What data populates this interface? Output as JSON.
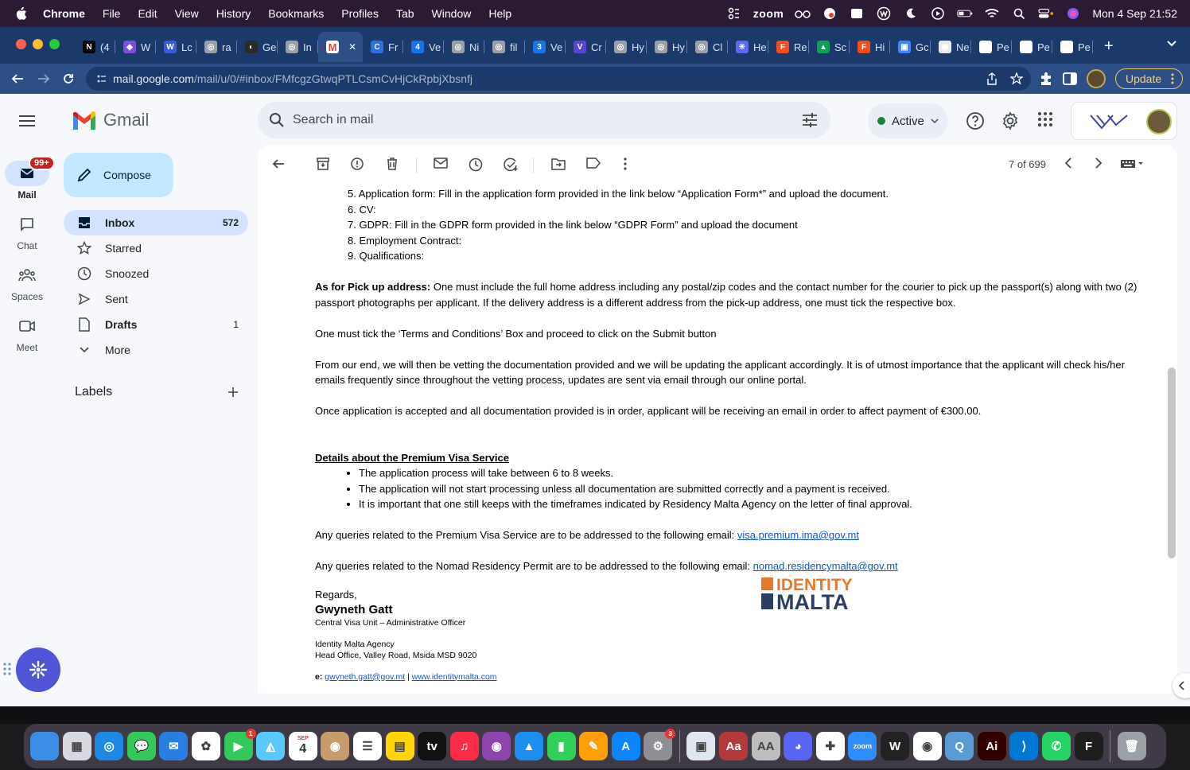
{
  "menubar": {
    "app": "Chrome",
    "items": [
      "File",
      "Edit",
      "View",
      "History",
      "Bookmarks",
      "Profiles",
      "Tab",
      "Window",
      "Help"
    ],
    "zoom_label": "zoom",
    "clock": "Mon 4 Sep  21:52"
  },
  "tabs": [
    {
      "label": "(4",
      "color": "#000000",
      "glyph": "N"
    },
    {
      "label": "W",
      "color": "#7b4fd8",
      "glyph": "◆"
    },
    {
      "label": "Lc",
      "color": "#3b5bdb",
      "glyph": "W"
    },
    {
      "label": "ra",
      "color": "#9aa0a6",
      "glyph": "◎"
    },
    {
      "label": "Ge",
      "color": "#2a2a2a",
      "glyph": "◐"
    },
    {
      "label": "In",
      "color": "#9aa0a6",
      "glyph": "◎"
    },
    {
      "label": "",
      "color": "#ffffff",
      "glyph": "M",
      "active": true
    },
    {
      "label": "Fr",
      "color": "#2f6fe0",
      "glyph": "C"
    },
    {
      "label": "Ve",
      "color": "#1a73e8",
      "glyph": "4"
    },
    {
      "label": "Ni",
      "color": "#9aa0a6",
      "glyph": "◎"
    },
    {
      "label": "fil",
      "color": "#9aa0a6",
      "glyph": "◎"
    },
    {
      "label": "Ve",
      "color": "#1a73e8",
      "glyph": "3"
    },
    {
      "label": "Cr",
      "color": "#5b43d6",
      "glyph": "V"
    },
    {
      "label": "Hy",
      "color": "#9aa0a6",
      "glyph": "◎"
    },
    {
      "label": "Hy",
      "color": "#9aa0a6",
      "glyph": "◎"
    },
    {
      "label": "Cl",
      "color": "#9aa0a6",
      "glyph": "◎"
    },
    {
      "label": "He",
      "color": "#5b6bf0",
      "glyph": "✳"
    },
    {
      "label": "Re",
      "color": "#f24e1e",
      "glyph": "F"
    },
    {
      "label": "Sc",
      "color": "#0f9d58",
      "glyph": "▲"
    },
    {
      "label": "Hi",
      "color": "#f24e1e",
      "glyph": "F"
    },
    {
      "label": "Gc",
      "color": "#4285f4",
      "glyph": "▣"
    },
    {
      "label": "Ne",
      "color": "#e8eaed",
      "glyph": "◉"
    },
    {
      "label": "Pe",
      "color": "#ffffff",
      "glyph": "●"
    },
    {
      "label": "Pe",
      "color": "#ffffff",
      "glyph": "●"
    },
    {
      "label": "Pe",
      "color": "#ffffff",
      "glyph": "●"
    }
  ],
  "address": {
    "host": "mail.google.com",
    "path": "/mail/u/0/#inbox/FMfcgzGtwqPTLCsmCvHjCkRpbjXbsnfj"
  },
  "toolbar": {
    "update_label": "Update"
  },
  "gmail": {
    "logo_text": "Gmail",
    "search_placeholder": "Search in mail",
    "status": "Active",
    "compose": "Compose",
    "rail": {
      "mail": "Mail",
      "mail_badge": "99+",
      "chat": "Chat",
      "spaces": "Spaces",
      "meet": "Meet"
    },
    "nav": [
      {
        "label": "Inbox",
        "count": "572",
        "icon": "inbox-icon"
      },
      {
        "label": "Starred",
        "count": "",
        "icon": "star-icon"
      },
      {
        "label": "Snoozed",
        "count": "",
        "icon": "clock-icon"
      },
      {
        "label": "Sent",
        "count": "",
        "icon": "send-icon"
      },
      {
        "label": "Drafts",
        "count": "1",
        "icon": "draft-icon"
      },
      {
        "label": "More",
        "count": "",
        "icon": "chevron-down-icon"
      }
    ],
    "labels_heading": "Labels",
    "pager": "7 of 699"
  },
  "email": {
    "ol_items": [
      "5. Application form:  Fill in the application form provided in the link below “Application Form*” and upload the document.",
      "6. CV:",
      "7. GDPR: Fill in the GDPR form provided in the link below “GDPR Form” and upload the document",
      "8. Employment Contract:",
      "9. Qualifications:"
    ],
    "pickup_bold": "As for Pick up address:",
    "pickup_text": " One must include the full home address including any postal/zip codes and the contact number for the courier to pick up the passport(s) along with two (2) passport photographs per applicant.  If the delivery address is a different address from the pick-up address, one must tick the respective box.",
    "terms": "One must tick the ‘Terms and Conditions’ Box and proceed to click on the Submit button",
    "vetting": "From our end, we will then be vetting the documentation provided and we will be updating the applicant accordingly.  It is of utmost importance that the applicant will check his/her emails frequently since throughout the vetting process, updates are sent via email through our online portal.",
    "payment": "Once application is accepted and all documentation provided is in order, applicant will be receiving an email in order to affect payment of €300.00.",
    "premium_heading": "Details about the Premium Visa Service",
    "premium_items": [
      "The application process will take between 6 to 8 weeks.",
      "The application will not start processing unless all documentation are submitted correctly and a payment is received.",
      "It is important that one still keeps with the timeframes indicated by Residency Malta Agency on the letter of final approval."
    ],
    "premium_query": "Any queries related to the Premium Visa Service are to be addressed to the following email: ",
    "premium_email": "visa.premium.ima@gov.mt",
    "nomad_query": "Any queries related to the Nomad Residency Permit are to be addressed to the following email: ",
    "nomad_email": "nomad.residencymalta@gov.mt",
    "regards": "Regards,",
    "sig_name": "Gwyneth Gatt",
    "sig_title": "Central Visa Unit – Administrative Officer",
    "sig_org": "Identity Malta Agency",
    "sig_addr": "Head Office, Valley Road, Msida MSD 9020",
    "sig_e_label": "e:",
    "sig_email": "gwyneth.gatt@gov.mt",
    "sig_sep": " | ",
    "sig_web": "www.identitymalta.com",
    "logo_line1": "IDENTITY",
    "logo_line2": "MALTA"
  },
  "dock": {
    "apps": [
      {
        "name": "finder",
        "color": "#3a8ee6",
        "glyph": ""
      },
      {
        "name": "launchpad",
        "color": "#d8d8e0",
        "glyph": "▦"
      },
      {
        "name": "safari",
        "color": "#1e88e5",
        "glyph": "◎"
      },
      {
        "name": "messages",
        "color": "#34c759",
        "glyph": "💬"
      },
      {
        "name": "mail",
        "color": "#2a7de1",
        "glyph": "✉"
      },
      {
        "name": "photos",
        "color": "#ffffff",
        "glyph": "✿"
      },
      {
        "name": "facetime",
        "color": "#34c759",
        "glyph": "▶",
        "badge": "1"
      },
      {
        "name": "maps",
        "color": "#5ac8fa",
        "glyph": "◭"
      },
      {
        "name": "calendar",
        "color": "#ffffff",
        "glyph": "4",
        "month": "SEP"
      },
      {
        "name": "contacts",
        "color": "#c69c6d",
        "glyph": "◉"
      },
      {
        "name": "reminders",
        "color": "#ffffff",
        "glyph": "☰"
      },
      {
        "name": "notes",
        "color": "#ffd60a",
        "glyph": "▤"
      },
      {
        "name": "apple-tv",
        "color": "#111111",
        "glyph": "tv"
      },
      {
        "name": "music",
        "color": "#fa2d48",
        "glyph": "♫"
      },
      {
        "name": "podcasts",
        "color": "#8e44ad",
        "glyph": "◉"
      },
      {
        "name": "keynote",
        "color": "#1f8ef1",
        "glyph": "▲"
      },
      {
        "name": "numbers",
        "color": "#30d158",
        "glyph": "▮"
      },
      {
        "name": "pages",
        "color": "#ff9f0a",
        "glyph": "✎"
      },
      {
        "name": "app-store",
        "color": "#0a84ff",
        "glyph": "A"
      },
      {
        "name": "system-settings",
        "color": "#8e8e93",
        "glyph": "⚙",
        "badge": "3"
      },
      {
        "name": "sep"
      },
      {
        "name": "preview",
        "color": "#e0e6ef",
        "glyph": "▣"
      },
      {
        "name": "dictionary",
        "color": "#b23a3a",
        "glyph": "Aa"
      },
      {
        "name": "font-book",
        "color": "#bdbdbd",
        "glyph": "AA"
      },
      {
        "name": "discord",
        "color": "#5865f2",
        "glyph": "◕"
      },
      {
        "name": "slack",
        "color": "#ffffff",
        "glyph": "✚"
      },
      {
        "name": "zoom",
        "color": "#2d8cff",
        "glyph": "zoom"
      },
      {
        "name": "webflow",
        "color": "#222222",
        "glyph": "W"
      },
      {
        "name": "chrome",
        "color": "#ffffff",
        "glyph": "◉"
      },
      {
        "name": "quicktime",
        "color": "#5b9bd5",
        "glyph": "Q"
      },
      {
        "name": "illustrator",
        "color": "#330000",
        "glyph": "Ai"
      },
      {
        "name": "vscode",
        "color": "#0078d4",
        "glyph": "⟩"
      },
      {
        "name": "whatsapp",
        "color": "#25d366",
        "glyph": "✆"
      },
      {
        "name": "figma",
        "color": "#1e1e1e",
        "glyph": "F"
      },
      {
        "name": "sep"
      },
      {
        "name": "trash",
        "color": "#9aa0a6",
        "glyph": "🗑"
      }
    ]
  }
}
